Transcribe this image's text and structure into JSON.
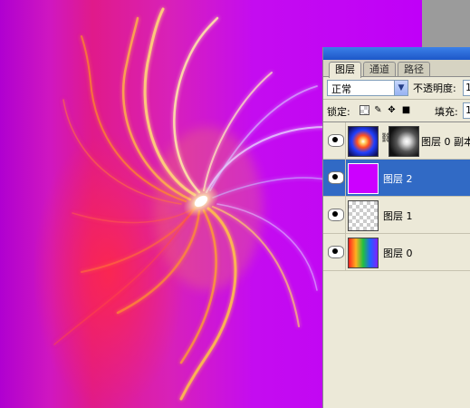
{
  "canvas": {
    "name": "swirl-artwork",
    "colors": {
      "background": "#c000f8",
      "left": "#b000d0",
      "red": "#ff2846",
      "light": "#ffe27a"
    }
  },
  "layers_panel": {
    "tabs": [
      {
        "label": "图层",
        "active": true
      },
      {
        "label": "通道",
        "active": false
      },
      {
        "label": "路径",
        "active": false
      }
    ],
    "blend_mode": "正常",
    "opacity_label": "不透明度:",
    "opacity_value": "1",
    "lock_label": "锁定:",
    "lock_icons": [
      "lock-transparent-pixels-icon",
      "lock-image-pixels-icon",
      "lock-position-icon",
      "lock-all-icon"
    ],
    "fill_label": "填充:",
    "fill_value": "1",
    "layers": [
      {
        "name": "图层 0 副本",
        "visible": true,
        "selected": false,
        "has_mask": true
      },
      {
        "name": "图层 2",
        "visible": true,
        "selected": true,
        "has_mask": false
      },
      {
        "name": "图层 1",
        "visible": true,
        "selected": false,
        "has_mask": false
      },
      {
        "name": "图层 0",
        "visible": true,
        "selected": false,
        "has_mask": false
      }
    ],
    "colors": {
      "selected_row": "#316ac5",
      "panel_bg": "#ece9d8",
      "layer2_fill": "#cc00ff"
    }
  }
}
